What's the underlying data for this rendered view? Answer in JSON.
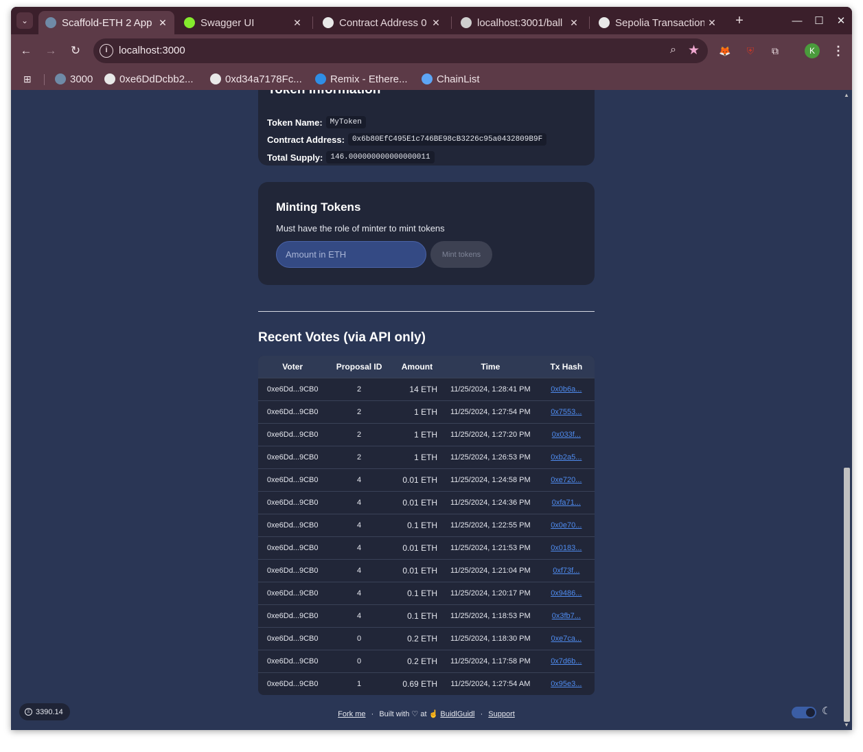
{
  "browser": {
    "tabs": [
      {
        "title": "Scaffold-ETH 2 App",
        "active": true,
        "favicon_color": "#6f8aa7"
      },
      {
        "title": "Swagger UI",
        "active": false,
        "favicon_color": "#85ea2d"
      },
      {
        "title": "Contract Address 0",
        "active": false,
        "favicon_color": "#e8e8e8"
      },
      {
        "title": "localhost:3001/ball",
        "active": false,
        "favicon_color": "#cfcfcf"
      },
      {
        "title": "Sepolia Transaction",
        "active": false,
        "favicon_color": "#e8e8e8"
      }
    ],
    "url": "localhost:3000",
    "profile_initial": "K",
    "bookmarks": [
      {
        "label": "3000",
        "icon_color": "#6f8aa7"
      },
      {
        "label": "0xe6DdDcbb2...",
        "icon_color": "#e8e8e8"
      },
      {
        "label": "0xd34a7178Fc...",
        "icon_color": "#e8e8e8"
      },
      {
        "label": "Remix - Ethere...",
        "icon_color": "#2f8ee5"
      },
      {
        "label": "ChainList",
        "icon_color": "#5da5f5"
      }
    ]
  },
  "token_info": {
    "heading": "Token Information",
    "name_label": "Token Name:",
    "name_value": "MyToken",
    "address_label": "Contract Address:",
    "address_value": "0x6b80EfC495E1c746BE98cB3226c95a0432809B9F",
    "supply_label": "Total Supply:",
    "supply_value": "146.000000000000000011"
  },
  "minting": {
    "heading": "Minting Tokens",
    "description": "Must have the role of minter to mint tokens",
    "input_placeholder": "Amount in ETH",
    "button_label": "Mint tokens"
  },
  "votes": {
    "heading": "Recent Votes (via API only)",
    "columns": [
      "Voter",
      "Proposal ID",
      "Amount",
      "Time",
      "Tx Hash"
    ],
    "rows": [
      {
        "voter": "0xe6Dd...9CB0",
        "proposal": "2",
        "amount": "14 ETH",
        "time": "11/25/2024, 1:28:41 PM",
        "hash": "0x0b6a..."
      },
      {
        "voter": "0xe6Dd...9CB0",
        "proposal": "2",
        "amount": "1 ETH",
        "time": "11/25/2024, 1:27:54 PM",
        "hash": "0x7553..."
      },
      {
        "voter": "0xe6Dd...9CB0",
        "proposal": "2",
        "amount": "1 ETH",
        "time": "11/25/2024, 1:27:20 PM",
        "hash": "0x033f..."
      },
      {
        "voter": "0xe6Dd...9CB0",
        "proposal": "2",
        "amount": "1 ETH",
        "time": "11/25/2024, 1:26:53 PM",
        "hash": "0xb2a5..."
      },
      {
        "voter": "0xe6Dd...9CB0",
        "proposal": "4",
        "amount": "0.01 ETH",
        "time": "11/25/2024, 1:24:58 PM",
        "hash": "0xe720..."
      },
      {
        "voter": "0xe6Dd...9CB0",
        "proposal": "4",
        "amount": "0.01 ETH",
        "time": "11/25/2024, 1:24:36 PM",
        "hash": "0xfa71..."
      },
      {
        "voter": "0xe6Dd...9CB0",
        "proposal": "4",
        "amount": "0.1 ETH",
        "time": "11/25/2024, 1:22:55 PM",
        "hash": "0x0e70..."
      },
      {
        "voter": "0xe6Dd...9CB0",
        "proposal": "4",
        "amount": "0.01 ETH",
        "time": "11/25/2024, 1:21:53 PM",
        "hash": "0x0183..."
      },
      {
        "voter": "0xe6Dd...9CB0",
        "proposal": "4",
        "amount": "0.01 ETH",
        "time": "11/25/2024, 1:21:04 PM",
        "hash": "0xf73f..."
      },
      {
        "voter": "0xe6Dd...9CB0",
        "proposal": "4",
        "amount": "0.1 ETH",
        "time": "11/25/2024, 1:20:17 PM",
        "hash": "0x9486..."
      },
      {
        "voter": "0xe6Dd...9CB0",
        "proposal": "4",
        "amount": "0.1 ETH",
        "time": "11/25/2024, 1:18:53 PM",
        "hash": "0x3fb7..."
      },
      {
        "voter": "0xe6Dd...9CB0",
        "proposal": "0",
        "amount": "0.2 ETH",
        "time": "11/25/2024, 1:18:30 PM",
        "hash": "0xe7ca..."
      },
      {
        "voter": "0xe6Dd...9CB0",
        "proposal": "0",
        "amount": "0.2 ETH",
        "time": "11/25/2024, 1:17:58 PM",
        "hash": "0x7d6b..."
      },
      {
        "voter": "0xe6Dd...9CB0",
        "proposal": "1",
        "amount": "0.69 ETH",
        "time": "11/25/2024, 1:27:54 AM",
        "hash": "0x95e3..."
      }
    ]
  },
  "footer": {
    "fork_me": "Fork me",
    "built_with": "Built with",
    "at": "at",
    "buidlguidl": "BuidlGuidl",
    "support": "Support",
    "separator": "·"
  },
  "eth_price": "3390.14"
}
